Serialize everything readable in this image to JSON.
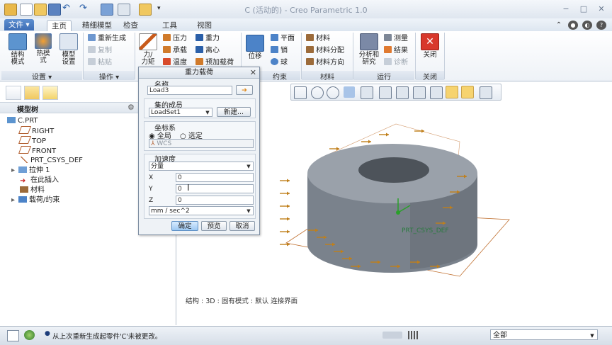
{
  "window": {
    "title": "C (活动的) - Creo Parametric 1.0"
  },
  "menu_tabs": [
    {
      "label": "文件 ▾"
    },
    {
      "label": "主页"
    },
    {
      "label": "精细模型"
    },
    {
      "label": "检查"
    },
    {
      "label": "工具"
    },
    {
      "label": "视图"
    }
  ],
  "ribbon": {
    "setup": {
      "label": "设置 ▾",
      "structural": "结构\n模式",
      "thermal": "热模\n式",
      "model_setup": "模型\n设置"
    },
    "operations": {
      "label": "操作 ▾",
      "regenerate": "重新生成",
      "copy": "复制",
      "paste": "粘贴"
    },
    "loads": {
      "force_moment": "力/\n力矩",
      "pressure": "压力",
      "bearing": "承载",
      "temperature": "温度",
      "gravity": "重力",
      "centrifugal": "离心",
      "preload": "预加载荷"
    },
    "constraints": {
      "label": "约束",
      "displacement": "位移",
      "plane": "平面",
      "pin": "销",
      "ball": "球"
    },
    "material": {
      "label": "材料",
      "material": "材料",
      "material_assign": "材料分配",
      "material_orient": "材料方向"
    },
    "run": {
      "label": "运行",
      "analysis": "分析和\n研究",
      "measure": "测量",
      "results": "结果",
      "diagnostics": "诊断"
    },
    "close": {
      "label": "关闭",
      "close": "关闭"
    }
  },
  "model_tree": {
    "header": "模型树",
    "items": [
      {
        "label": "C.PRT"
      },
      {
        "label": "RIGHT"
      },
      {
        "label": "TOP"
      },
      {
        "label": "FRONT"
      },
      {
        "label": "PRT_CSYS_DEF"
      },
      {
        "label": "拉伸 1"
      },
      {
        "label": "在此插入"
      },
      {
        "label": "材料"
      },
      {
        "label": "载荷/约束"
      }
    ]
  },
  "dialog": {
    "title": "重力载荷",
    "name_label": "名称",
    "name_value": "Load3",
    "set_label": "集的成员",
    "set_value": "LoadSet1",
    "new_button": "新建...",
    "csys_label": "坐标系",
    "csys_global": "全局",
    "csys_selected": "选定",
    "csys_value": "WCS",
    "accel_label": "加速度",
    "accel_mode": "分量",
    "x_label": "X",
    "x_value": "0",
    "y_label": "Y",
    "y_value": "0",
    "z_label": "Z",
    "z_value": "0",
    "units": "mm / sec^2",
    "ok": "确定",
    "preview": "预览",
    "cancel": "取消"
  },
  "graphics": {
    "status_text": "结构 : 3D : 固有模式 : 默认 连接界面",
    "csys_label": "PRT_CSYS_DEF",
    "model_color": "#7a828c",
    "load_arrow_color": "#c07f1a",
    "datum_color": "#c07030"
  },
  "statusbar": {
    "message": "从上次重新生成起零件'C'未被更改。",
    "filter": "全部"
  },
  "colors": {
    "accent": "#3c6db5",
    "active_tool": "#f6d36f"
  }
}
